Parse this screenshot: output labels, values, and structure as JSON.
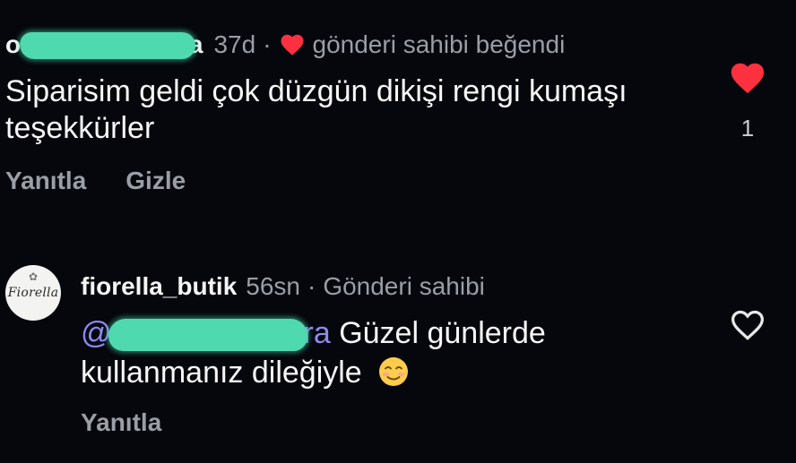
{
  "comment1": {
    "username_visible_start": "o",
    "username_visible_end": "ra",
    "time": "37d",
    "separator": "·",
    "liked_by_author": "gönderi sahibi beğendi",
    "text": "Siparisim geldi çok düzgün dikişi rengi kumaşı teşekkürler",
    "reply_label": "Yanıtla",
    "hide_label": "Gizle",
    "like_count": "1",
    "liked": true
  },
  "comment2": {
    "avatar_text": "Fiorella",
    "username": "fiorella_butik",
    "time": "56sn",
    "separator": "·",
    "author_badge": "Gönderi sahibi",
    "mention_start": "@",
    "mention_end": "ra",
    "text": "Güzel günlerde kullanmanız dileğiyle",
    "reply_label": "Yanıtla",
    "liked": false
  },
  "colors": {
    "background": "#05070c",
    "heart_red": "#ff3040",
    "muted_text": "#9a9ea6",
    "mention": "#8f88f5",
    "redaction": "#4fd9ae"
  },
  "icons": {
    "small_liked_heart": "heart-filled-icon",
    "comment1_like": "heart-filled-icon",
    "comment2_like": "heart-outline-icon",
    "emoji": "smiling-face-emoji"
  }
}
